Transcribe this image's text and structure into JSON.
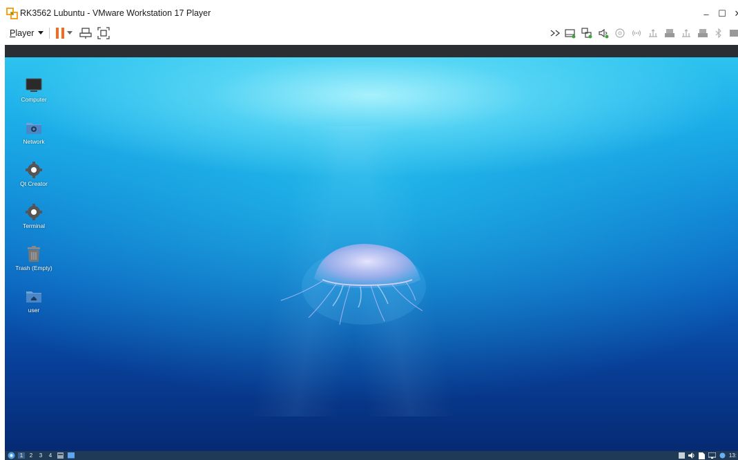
{
  "window": {
    "title": "RK3562 Lubuntu - VMware Workstation 17 Player",
    "controls": {
      "minimize": "–",
      "maximize": "☐",
      "close": "✕"
    }
  },
  "toolbar": {
    "player_label_first": "P",
    "player_label_rest": "layer",
    "icons": [
      "pause-icon",
      "dropdown-arrow-icon",
      "send-ctrl-alt-del-icon",
      "fullscreen-icon"
    ],
    "device_icons": [
      "more-icon",
      "hard-disk-icon",
      "network-adapter-icon",
      "sound-icon",
      "cd-dvd-icon",
      "wireless-icon",
      "usb-device-icon",
      "printer-icon",
      "usb-device-2-icon",
      "printer-2-icon",
      "bluetooth-icon",
      "display-icon"
    ]
  },
  "desktop": {
    "icons": [
      {
        "label": "Computer",
        "icon": "computer-icon"
      },
      {
        "label": "Network",
        "icon": "network-folder-icon"
      },
      {
        "label": "Qt Creator",
        "icon": "qt-creator-icon"
      },
      {
        "label": "Terminal",
        "icon": "terminal-icon"
      },
      {
        "label": "Trash (Empty)",
        "icon": "trash-icon"
      },
      {
        "label": "user",
        "icon": "home-folder-icon"
      }
    ]
  },
  "taskbar": {
    "workspaces": [
      "1",
      "2",
      "3",
      "4"
    ],
    "active_workspace": "1",
    "clock": "13:"
  },
  "colors": {
    "pause_accent": "#f26b21",
    "taskbar_bg": "#1f3a57",
    "vm_strip": "#2b2f33"
  }
}
